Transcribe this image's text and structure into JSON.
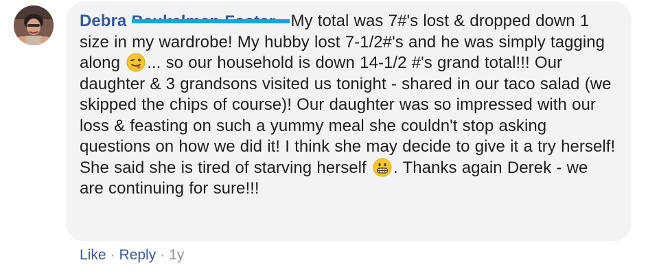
{
  "comment": {
    "author_visible": "Debra",
    "author_redacted_fragment": "Beukelman Foster",
    "text_part1": "My total was 7#'s lost & dropped down 1 size in my wardrobe! My hubby lost 7-1/2#'s and he was simply tagging along",
    "emoji1": "winking-tongue-emoji",
    "text_part2": "... so our household is down 14-1/2 #'s grand total!!! Our daughter & 3 grandsons visited us tonight - shared in our taco salad (we skipped the chips of course)! Our daughter was so impressed with our loss & feasting on such a yummy meal she couldn't stop asking questions on how we did it! I think she may decide to give it a try herself! She said she is tired of starving herself",
    "emoji2": "grimacing-emoji",
    "text_part3": ". Thanks again Derek - we are continuing for sure!!!"
  },
  "actions": {
    "like_label": "Like",
    "separator": "·",
    "reply_label": "Reply",
    "timestamp": "1y"
  },
  "colors": {
    "author": "#385898",
    "text": "#1c1e21",
    "bubble": "#f2f3f5",
    "meta": "#90949c",
    "redaction": "#19a3d8"
  }
}
